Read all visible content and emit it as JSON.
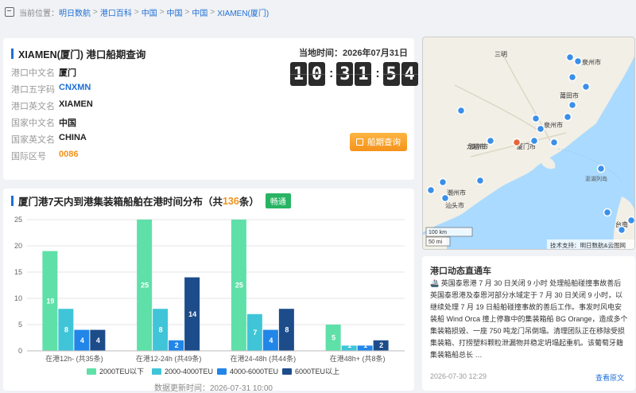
{
  "breadcrumb": {
    "prefix": "当前位置：",
    "items": [
      "明日数航",
      "港口百科",
      "中国",
      "中国",
      "中国",
      "XIAMEN(厦门)"
    ]
  },
  "port": {
    "title": "XIAMEN(厦门) 港口船期查询",
    "fields": [
      {
        "label": "港口中文名",
        "value": "厦门",
        "style": "normal"
      },
      {
        "label": "港口五字码",
        "value": "CNXMN",
        "style": "blue"
      },
      {
        "label": "港口英文名",
        "value": "XIAMEN",
        "style": "normal"
      },
      {
        "label": "国家中文名",
        "value": "中国",
        "style": "normal"
      },
      {
        "label": "国家英文名",
        "value": "CHINA",
        "style": "normal"
      },
      {
        "label": "国际区号",
        "value": "0086",
        "style": "orange"
      }
    ],
    "local_time_label": "当地时间：2026年07月31日",
    "clock": [
      "1",
      "0",
      "3",
      "1",
      "5",
      "4"
    ],
    "schedule_button": "船期查询"
  },
  "chart_section": {
    "title_prefix": "厦门港7天内到港集装箱船舶在港时间分布（共 ",
    "count": "136",
    "title_suffix": " 条）",
    "tag": "畅通",
    "update_time": "数据更新时间：2026-07-31 10:00"
  },
  "chart_data": {
    "type": "bar",
    "categories": [
      "在港12h- (共35条)",
      "在港12-24h (共49条)",
      "在港24-48h (共44条)",
      "在港48h+ (共8条)"
    ],
    "series": [
      {
        "name": "2000TEU以下",
        "color": "#5ee0a8",
        "values": [
          19,
          25,
          25,
          5
        ]
      },
      {
        "name": "2000-4000TEU",
        "color": "#40c5d8",
        "values": [
          8,
          8,
          7,
          1
        ]
      },
      {
        "name": "4000-6000TEU",
        "color": "#2186e8",
        "values": [
          4,
          2,
          4,
          1
        ]
      },
      {
        "name": "6000TEU以上",
        "color": "#1d4c8a",
        "values": [
          4,
          14,
          8,
          2
        ]
      }
    ],
    "ylim": [
      0,
      25
    ],
    "yticks": [
      0,
      5,
      10,
      15,
      20,
      25
    ],
    "grid": true,
    "legend_position": "bottom"
  },
  "map": {
    "labels": [
      "三明",
      "漳州市",
      "泉州市",
      "莆田市",
      "龙岩市",
      "潮州市",
      "汕头市",
      "厦门市",
      "泉州市",
      "澎湖列岛",
      "台南"
    ],
    "scale_km": "100 km",
    "scale_mi": "50 mi",
    "attribution": "技术支持：明日数航&云图网"
  },
  "news": {
    "title": "港口动态直通车",
    "body": "🚢 英国泰恩港 7 月 30 日关闭 9 小时 处理船舶碰撞事故善后 英国泰恩港及泰恩河部分水域定于 7 月 30 日关闭 9 小时，以继续处理 7 月 19 日船舶碰撞事故的善后工作。事发时风电安装船 Wind Orca 撞上停靠中的集装箱船 BG Orange，造成多个集装箱损毁、一座 750 吨龙门吊倒塌。清理团队正在移除受损集装箱、打捞塑料颗粒泄漏物并稳定坍塌起重机。该葡萄牙籍集装箱船总长 …",
    "date": "2026-07-30 12:29",
    "link": "查看原文"
  }
}
